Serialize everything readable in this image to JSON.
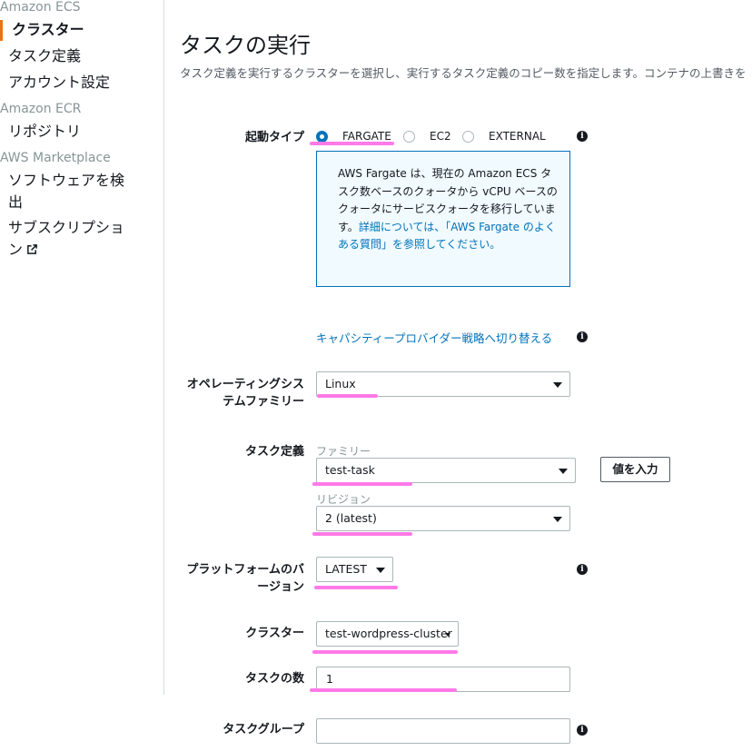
{
  "sidebar": {
    "sections": [
      {
        "title": "Amazon ECS",
        "items": [
          "クラスター",
          "タスク定義",
          "アカウント設定"
        ]
      },
      {
        "title": "Amazon ECR",
        "items": [
          "リポジトリ"
        ]
      },
      {
        "title": "AWS Marketplace",
        "items": [
          "ソフトウェアを検出",
          "サブスクリプション"
        ]
      }
    ]
  },
  "page": {
    "title": "タスクの実行",
    "description": "タスク定義を実行するクラスターを選択し、実行するタスク定義のコピー数を指定します。コンテナの上書きを"
  },
  "form": {
    "launch_type": {
      "label": "起動タイプ",
      "options": [
        "FARGATE",
        "EC2",
        "EXTERNAL"
      ],
      "selected": "FARGATE",
      "info_text": "AWS Fargate は、現在の Amazon ECS タスク数ベースのクォータから vCPU ベースのクォータにサービスクォータを移行しています。",
      "info_link": "詳細については、「AWS Fargate のよくある質問」を参照してください。"
    },
    "capacity_link": "キャパシティープロバイダー戦略へ切り替える",
    "os_family": {
      "label": "オペレーティングシステムファミリー",
      "value": "Linux"
    },
    "task_definition": {
      "label": "タスク定義",
      "family_label": "ファミリー",
      "family_value": "test-task",
      "revision_label": "リビジョン",
      "revision_value": "2 (latest)",
      "enter_value_button": "値を入力"
    },
    "platform_version": {
      "label": "プラットフォームのバージョン",
      "value": "LATEST"
    },
    "cluster": {
      "label": "クラスター",
      "value": "test-wordpress-cluster"
    },
    "task_count": {
      "label": "タスクの数",
      "value": "1"
    },
    "task_group": {
      "label": "タスクグループ",
      "value": ""
    }
  },
  "colors": {
    "accent": "#0073bb",
    "active_bar": "#ec7211",
    "highlight": "#ff7ae8"
  }
}
